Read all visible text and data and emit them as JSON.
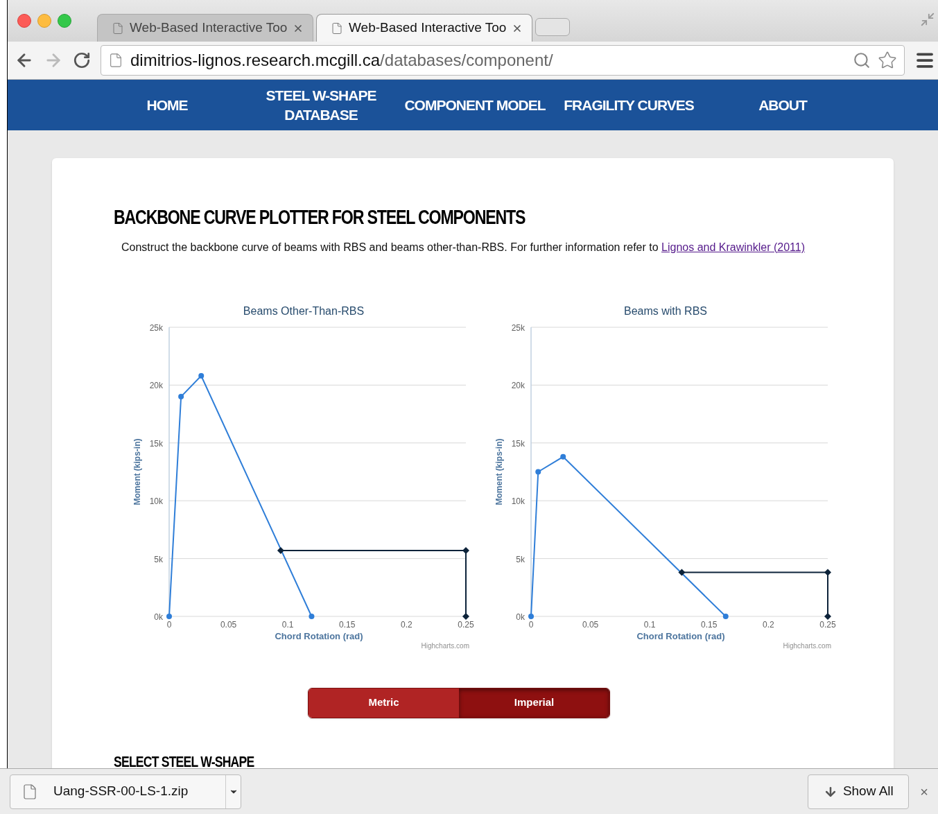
{
  "browser": {
    "tabs": [
      {
        "title": "Web-Based Interactive Too",
        "selected": false
      },
      {
        "title": "Web-Based Interactive Too",
        "selected": true
      }
    ],
    "address": {
      "host": "dimitrios-lignos.research.mcgill.ca",
      "path": "/databases/component/"
    }
  },
  "nav": [
    {
      "label": "HOME"
    },
    {
      "label": "STEEL W-SHAPE DATABASE"
    },
    {
      "label": "COMPONENT MODEL"
    },
    {
      "label": "FRAGILITY CURVES"
    },
    {
      "label": "ABOUT"
    }
  ],
  "heading": "BACKBONE CURVE PLOTTER FOR STEEL COMPONENTS",
  "intro": "Construct the backbone curve of beams with RBS and beams other-than-RBS. For further information refer to",
  "intro_link": "Lignos and Krawinkler (2011)",
  "charts": [
    {
      "credit": "Highcharts.com",
      "chart_data": {
        "type": "line",
        "title": "Beams Other-Than-RBS",
        "xlabel": "Chord Rotation (rad)",
        "ylabel": "Moment (kips-in)",
        "xlim": [
          0,
          0.25
        ],
        "ylim": [
          0,
          25000
        ],
        "xticks": [
          0,
          0.05,
          0.1,
          0.15,
          0.2,
          0.25
        ],
        "yticks": [
          {
            "value": 0,
            "label": "0k"
          },
          {
            "value": 5000,
            "label": "5k"
          },
          {
            "value": 10000,
            "label": "10k"
          },
          {
            "value": 15000,
            "label": "15k"
          },
          {
            "value": 20000,
            "label": "20k"
          },
          {
            "value": 25000,
            "label": "25k"
          }
        ],
        "grid": true,
        "series": [
          {
            "color": "#2f7ed8",
            "marker": "circle",
            "x": [
              0,
              0.01,
              0.027,
              0.12
            ],
            "values": [
              0,
              19000,
              20800,
              0
            ]
          },
          {
            "color": "#0d233a",
            "marker": "diamond",
            "x": [
              0.094,
              0.25,
              0.25
            ],
            "values": [
              5700,
              5700,
              0
            ]
          }
        ]
      }
    },
    {
      "credit": "Highcharts.com",
      "chart_data": {
        "type": "line",
        "title": "Beams with RBS",
        "xlabel": "Chord Rotation (rad)",
        "ylabel": "Moment (kips-in)",
        "xlim": [
          0,
          0.25
        ],
        "ylim": [
          0,
          25000
        ],
        "xticks": [
          0,
          0.05,
          0.1,
          0.15,
          0.2,
          0.25
        ],
        "yticks": [
          {
            "value": 0,
            "label": "0k"
          },
          {
            "value": 5000,
            "label": "5k"
          },
          {
            "value": 10000,
            "label": "10k"
          },
          {
            "value": 15000,
            "label": "15k"
          },
          {
            "value": 20000,
            "label": "20k"
          },
          {
            "value": 25000,
            "label": "25k"
          }
        ],
        "grid": true,
        "series": [
          {
            "color": "#2f7ed8",
            "marker": "circle",
            "x": [
              0,
              0.006,
              0.027,
              0.164
            ],
            "values": [
              0,
              12500,
              13800,
              0
            ]
          },
          {
            "color": "#0d233a",
            "marker": "diamond",
            "x": [
              0.127,
              0.25,
              0.25
            ],
            "values": [
              3800,
              3800,
              0
            ]
          }
        ]
      }
    }
  ],
  "units": [
    {
      "label": "Metric",
      "selected": false
    },
    {
      "label": "Imperial",
      "selected": true
    }
  ],
  "next_heading": "SELECT STEEL W-SHAPE",
  "download": {
    "file": "Uang-SSR-00-LS-1.zip",
    "show_all": "Show All",
    "close": "×"
  }
}
